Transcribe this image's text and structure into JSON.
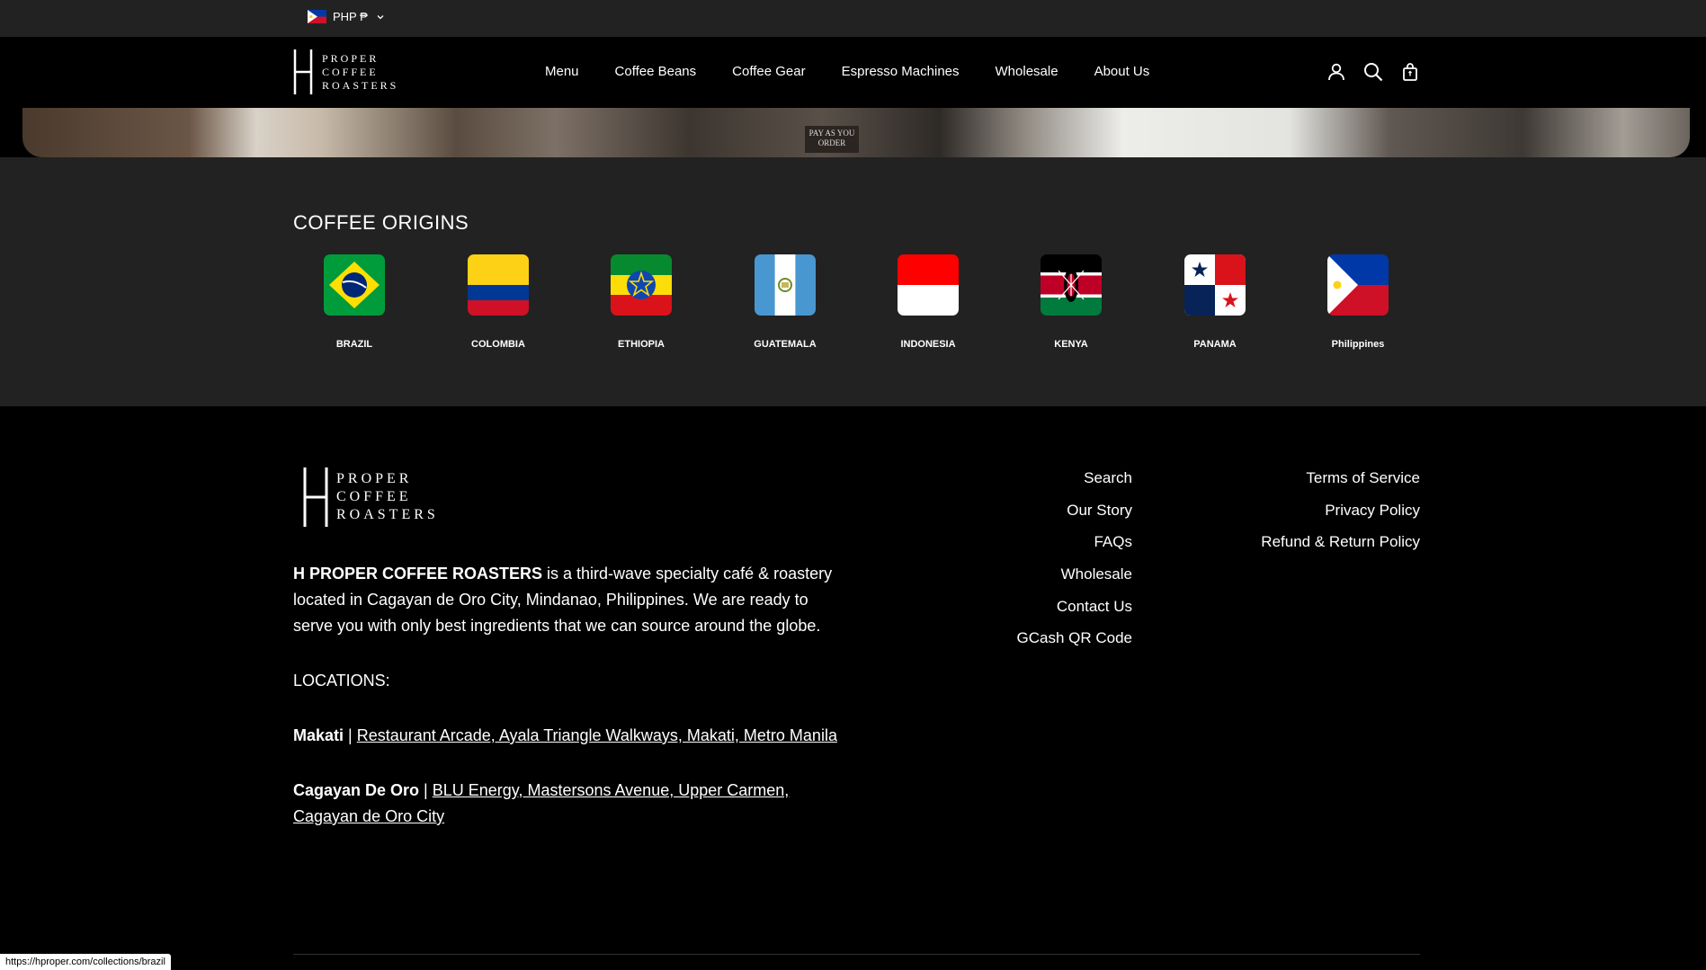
{
  "topbar": {
    "currency_label": "PHP ₱"
  },
  "brand": {
    "line1": "PROPER",
    "line2": "COFFEE",
    "line3": "ROASTERS"
  },
  "nav": {
    "items": [
      "Menu",
      "Coffee Beans",
      "Coffee Gear",
      "Espresso Machines",
      "Wholesale",
      "About Us"
    ]
  },
  "hero": {
    "sign_text": "PAY AS YOU ORDER"
  },
  "origins": {
    "title": "COFFEE ORIGINS",
    "items": [
      {
        "label": "BRAZIL",
        "flag": "brazil-flag-icon"
      },
      {
        "label": "COLOMBIA",
        "flag": "colombia-flag-icon"
      },
      {
        "label": "ETHIOPIA",
        "flag": "ethiopia-flag-icon"
      },
      {
        "label": "GUATEMALA",
        "flag": "guatemala-flag-icon"
      },
      {
        "label": "INDONESIA",
        "flag": "indonesia-flag-icon"
      },
      {
        "label": "KENYA",
        "flag": "kenya-flag-icon"
      },
      {
        "label": "PANAMA",
        "flag": "panama-flag-icon"
      },
      {
        "label": "Philippines",
        "flag": "philippines-flag-icon"
      }
    ]
  },
  "footer": {
    "about": {
      "brand_name": "H PROPER COFFEE ROASTERS",
      "description": " is a third-wave specialty café & roastery located in Cagayan de Oro City, Mindanao, Philippines. We are ready to serve you with only best ingredients that we can source around the globe.",
      "locations_title": "LOCATIONS:",
      "separator": " | ",
      "location1_name": "Makati",
      "location1_address": "Restaurant Arcade, Ayala Triangle Walkways, Makati, Metro Manila",
      "location2_name": "Cagayan De Oro",
      "location2_address": "BLU Energy, Mastersons Avenue, Upper Carmen, Cagayan de Oro City"
    },
    "links_col1": [
      "Search",
      "Our Story",
      "FAQs",
      "Wholesale",
      "Contact Us",
      "GCash QR Code"
    ],
    "links_col2": [
      "Terms of Service",
      "Privacy Policy",
      "Refund & Return Policy"
    ]
  },
  "statusbar": {
    "url": "https://hproper.com/collections/brazil"
  },
  "colors": {
    "topbar_bg": "#222222",
    "header_bg": "#000000",
    "origins_bg": "#222222",
    "footer_bg": "#000000"
  }
}
